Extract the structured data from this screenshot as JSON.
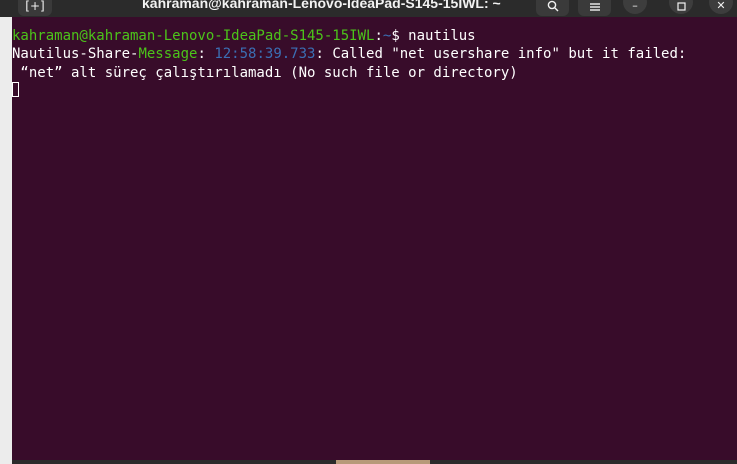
{
  "titlebar": {
    "title": "kahraman@kahraman-Lenovo-IdeaPad-S145-15IWL: ~",
    "new_tab_icon": "new-tab-icon",
    "search_icon": "search-icon",
    "menu_icon": "hamburger-menu-icon",
    "minimize_icon": "minimize-icon",
    "maximize_icon": "maximize-icon",
    "close_icon": "close-icon"
  },
  "terminal": {
    "lines": [
      {
        "prefix": "Nautilus-Share-",
        "tag": "Message",
        "colon": ": ",
        "timestamp": "12:58:39.733",
        "text": ": Called \"net usershare info\" but it failed:"
      },
      {
        "text": " “net” alt süreç çalıştırılamadı (No such file or directory)"
      }
    ],
    "prompt": {
      "user_host": "kahraman@kahraman-Lenovo-IdeaPad-S145-15IWL",
      "colon": ":",
      "cwd": "~",
      "symbol": "$ ",
      "command": "nautilus"
    }
  },
  "colors": {
    "terminal_bg": "#380c2a",
    "prompt_green": "#4cc41a",
    "timestamp_blue": "#3b6fb4",
    "text": "#ffffff"
  }
}
